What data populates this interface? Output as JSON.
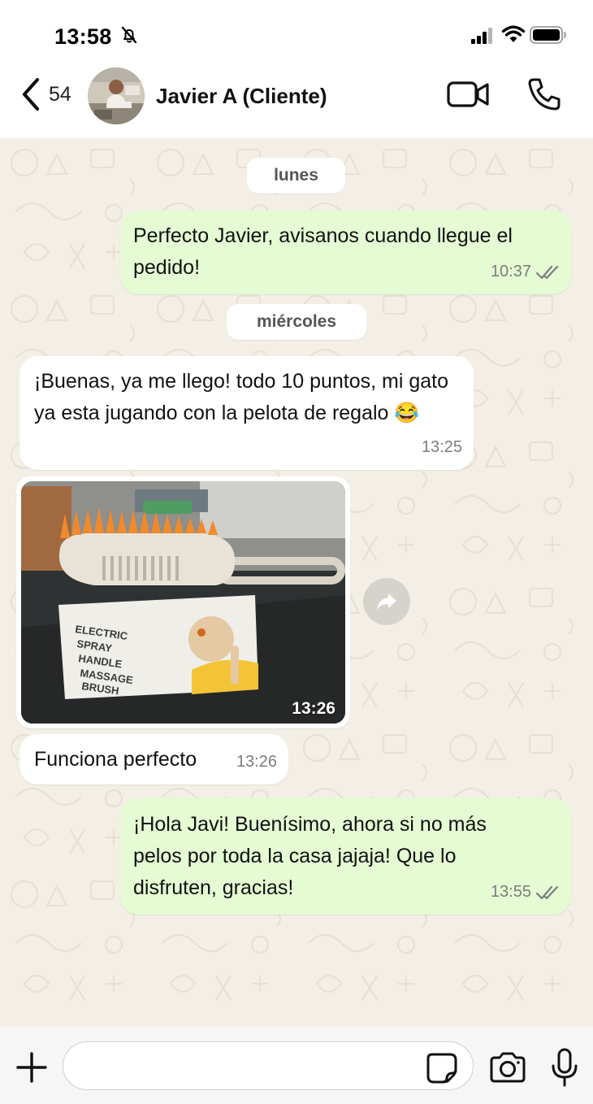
{
  "status_bar": {
    "time": "13:58"
  },
  "header": {
    "back_count": "54",
    "contact_name": "Javier A (Cliente)"
  },
  "chat": {
    "date_1": "lunes",
    "date_2": "miércoles",
    "messages": [
      {
        "direction": "out",
        "text": "Perfecto Javier, avisanos cuando llegue el pedido!",
        "time": "10:37",
        "status": "read"
      },
      {
        "direction": "in",
        "text": "¡Buenas, ya me llego! todo 10 puntos, mi gato ya esta jugando con la pelota de regalo",
        "emoji": "😂",
        "time": "13:25"
      },
      {
        "direction": "in",
        "type": "image",
        "time": "13:26"
      },
      {
        "direction": "in",
        "text": "Funciona perfecto",
        "time": "13:26"
      },
      {
        "direction": "out",
        "text": "¡Hola Javi! Buenísimo, ahora si no más pelos por toda la casa jajaja! Que lo disfruten, gracias!",
        "time": "13:55",
        "status": "read"
      }
    ],
    "photo_box_text": [
      "ELECTRIC",
      "SPRAY",
      "HANDLE",
      "MASSAGE",
      "BRUSH"
    ]
  },
  "composer": {
    "value": "",
    "placeholder": ""
  },
  "icons": {
    "status": [
      "bell-off-icon",
      "cellular-signal-icon",
      "wifi-icon",
      "battery-icon"
    ],
    "header": [
      "chevron-left-icon",
      "video-camera-icon",
      "phone-icon"
    ],
    "composer": [
      "plus-icon",
      "sticker-icon",
      "camera-icon",
      "microphone-icon"
    ],
    "chat": [
      "forward-icon",
      "double-check-icon"
    ]
  },
  "colors": {
    "outgoing_bubble": "#e4fbd3",
    "incoming_bubble": "#ffffff",
    "chat_background": "#f3efe6",
    "read_ticks": "#7d7d7d"
  }
}
